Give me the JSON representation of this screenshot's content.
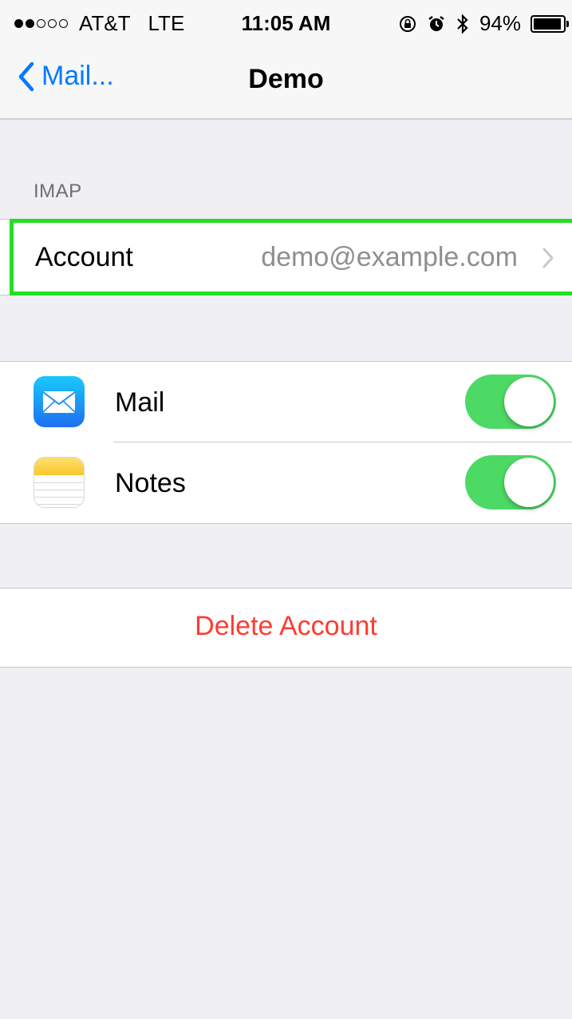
{
  "status_bar": {
    "carrier": "AT&T",
    "network": "LTE",
    "time": "11:05 AM",
    "battery_percent": "94%",
    "battery_level": 0.94,
    "signal_bars_filled": 2,
    "signal_bars_total": 5,
    "icons": [
      "orientation-lock-icon",
      "alarm-icon",
      "bluetooth-icon",
      "battery-icon"
    ]
  },
  "nav": {
    "back_label": "Mail...",
    "title": "Demo"
  },
  "section": {
    "header": "IMAP"
  },
  "account": {
    "label": "Account",
    "value": "demo@example.com"
  },
  "toggles": [
    {
      "label": "Mail",
      "icon": "mail-app-icon",
      "on": true
    },
    {
      "label": "Notes",
      "icon": "notes-app-icon",
      "on": true
    }
  ],
  "delete": {
    "label": "Delete Account"
  },
  "colors": {
    "accent": "#007aff",
    "toggle_on": "#4cd964",
    "destructive": "#ff3b30",
    "highlight": "#22e022",
    "secondary_text": "#8e8e93",
    "background": "#efeff4"
  }
}
